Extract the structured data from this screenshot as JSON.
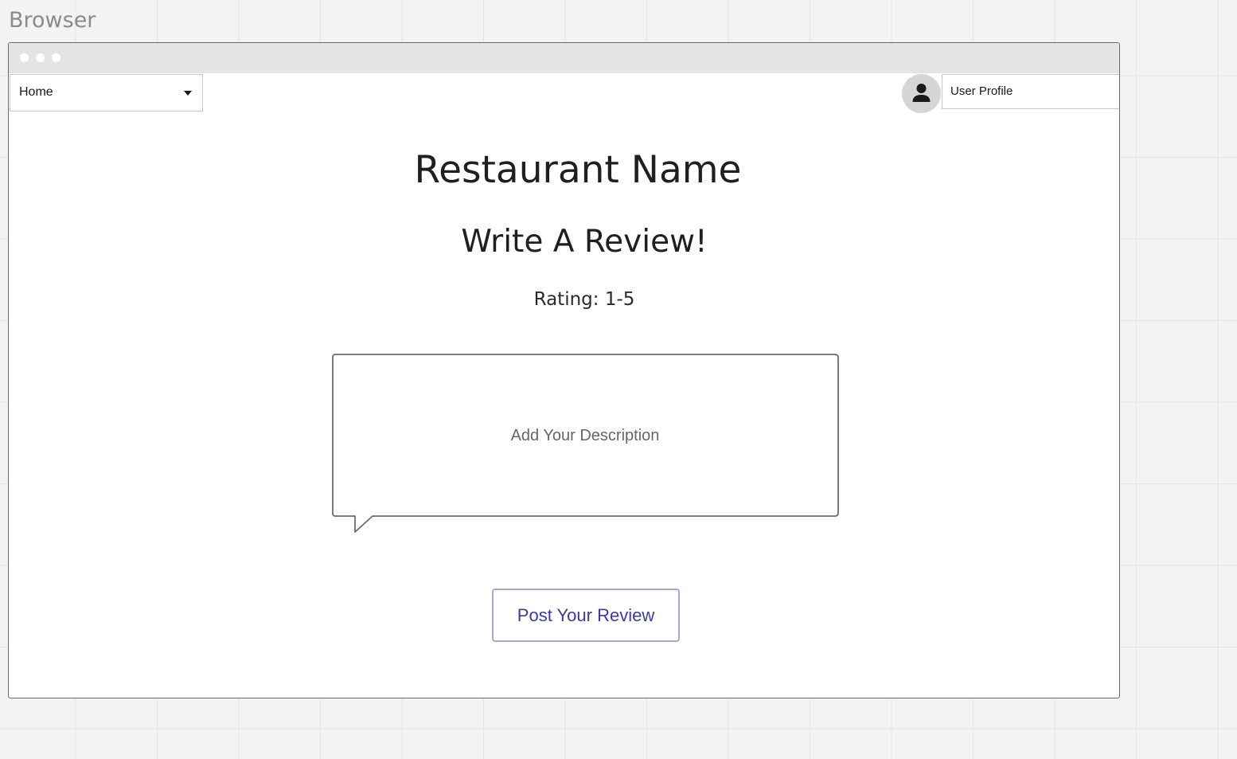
{
  "canvas": {
    "label": "Browser"
  },
  "nav": {
    "selected": "Home"
  },
  "user": {
    "avatar_icon": "person-icon",
    "profile_label": "User Profile"
  },
  "page": {
    "title": "Restaurant Name",
    "heading": "Write A Review!",
    "rating_label": "Rating: 1-5"
  },
  "review": {
    "description_placeholder": "Add Your Description",
    "description_value": "",
    "post_button_label": "Post Your Review"
  },
  "colors": {
    "canvas_background": "#f3f3f3",
    "window_chrome": "#e4e4e4",
    "button_border": "#a9a6dc",
    "button_text": "#3b3aa8",
    "avatar_background": "#d6d6d6"
  }
}
